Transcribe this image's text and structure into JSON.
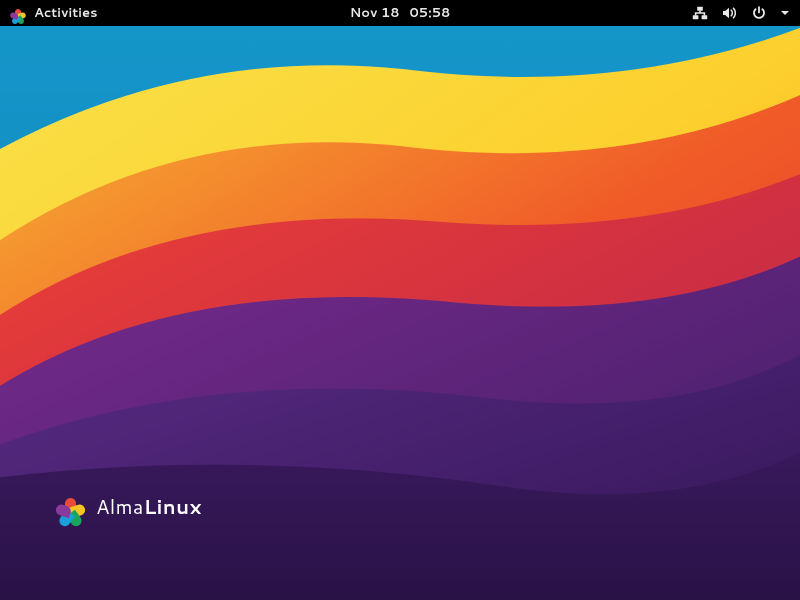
{
  "topbar": {
    "activities_label": "Activities",
    "clock_date": "Nov 18",
    "clock_time": "05:58"
  },
  "icons": {
    "system_logo": "almalinux-icon",
    "network": "network-wired-icon",
    "volume": "volume-high-icon",
    "power": "power-icon",
    "caret": "chevron-down-icon"
  },
  "brand": {
    "name_light": "Alma",
    "name_bold": "Linux"
  },
  "colors": {
    "petal_red": "#e84b3c",
    "petal_yellow": "#f7c325",
    "petal_green": "#1aa55d",
    "petal_blue": "#1a9fd8",
    "petal_purple": "#8a3a9b"
  }
}
